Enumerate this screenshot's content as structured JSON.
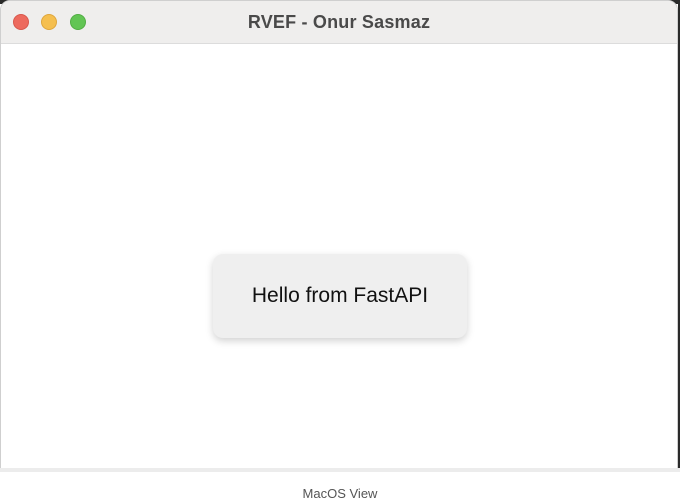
{
  "window": {
    "title": "RVEF - Onur Sasmaz",
    "controls": {
      "close": "close-button",
      "minimize": "minimize-button",
      "zoom": "zoom-button"
    }
  },
  "content": {
    "message": "Hello from FastAPI"
  },
  "caption": "MacOS View",
  "colors": {
    "close": "#ed6a5e",
    "minimize": "#f5bf4f",
    "zoom": "#62c554",
    "titlebar": "#efeeed",
    "card": "#efefef"
  }
}
